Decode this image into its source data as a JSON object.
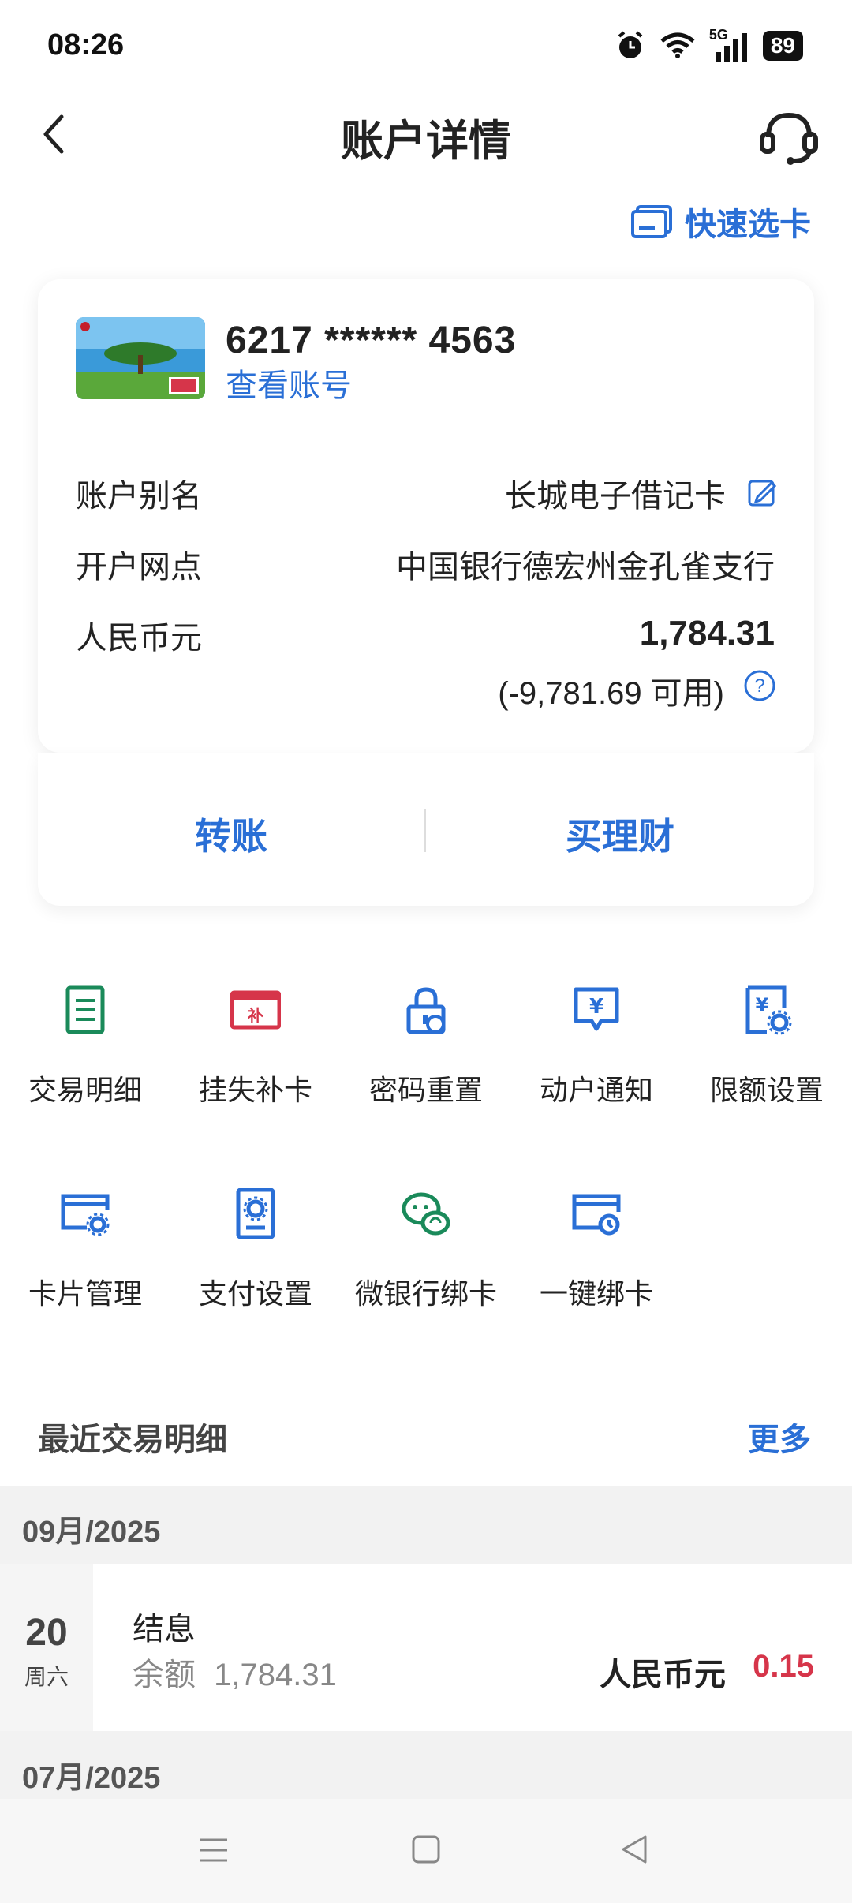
{
  "status_bar": {
    "time": "08:26",
    "network": "5G",
    "battery": "89"
  },
  "header": {
    "title": "账户详情",
    "quick_select": "快速选卡"
  },
  "card": {
    "number": "6217 ****** 4563",
    "view_account": "查看账号",
    "rows": [
      {
        "label": "账户别名",
        "value": "长城电子借记卡"
      },
      {
        "label": "开户网点",
        "value": "中国银行德宏州金孔雀支行"
      },
      {
        "label": "人民币元",
        "value": "1,784.31"
      }
    ],
    "available": "(-9,781.69 可用)",
    "actions": {
      "transfer": "转账",
      "buy_wealth": "买理财"
    }
  },
  "services": [
    {
      "label": "交易明细",
      "icon": "doc-icon"
    },
    {
      "label": "挂失补卡",
      "icon": "card-replace-icon"
    },
    {
      "label": "密码重置",
      "icon": "lock-reset-icon"
    },
    {
      "label": "动户通知",
      "icon": "yen-chat-icon"
    },
    {
      "label": "限额设置",
      "icon": "yen-gear-icon"
    },
    {
      "label": "卡片管理",
      "icon": "card-gear-icon"
    },
    {
      "label": "支付设置",
      "icon": "pay-settings-icon"
    },
    {
      "label": "微银行绑卡",
      "icon": "wechat-icon"
    },
    {
      "label": "一键绑卡",
      "icon": "card-bind-icon"
    }
  ],
  "recent": {
    "title": "最近交易明细",
    "more": "更多",
    "groups": [
      {
        "month": "09月/2025",
        "items": [
          {
            "day": "20",
            "weekday": "周六",
            "title": "结息",
            "balance_label": "余额",
            "balance": "1,784.31",
            "currency": "人民币元",
            "amount": "0.15"
          }
        ]
      },
      {
        "month": "07月/2025",
        "items": []
      }
    ]
  },
  "colors": {
    "accent": "#2a6fd6",
    "green": "#1a8a5a",
    "red": "#d6354a"
  }
}
